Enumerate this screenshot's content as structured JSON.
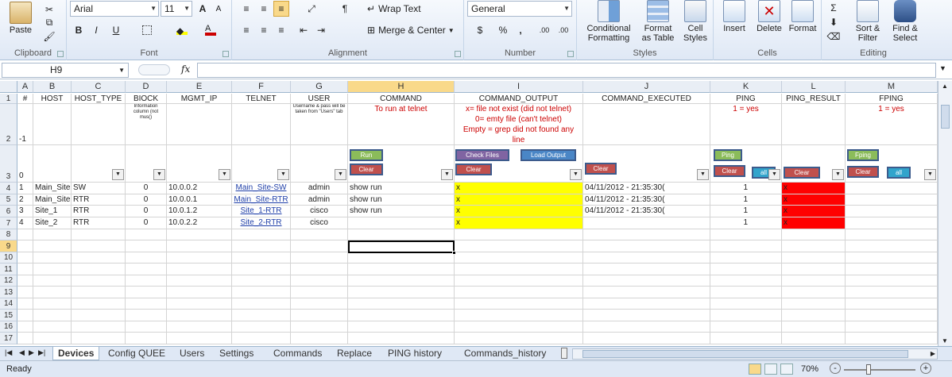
{
  "ribbon": {
    "clipboard": {
      "paste": "Paste",
      "label": "Clipboard"
    },
    "font": {
      "name": "Arial",
      "size": "11",
      "bold": "B",
      "italic": "I",
      "underline": "U",
      "grow": "A",
      "shrink": "A",
      "label": "Font"
    },
    "alignment": {
      "wrap_text": "Wrap Text",
      "merge_center": "Merge & Center",
      "label": "Alignment"
    },
    "number": {
      "format": "General",
      "currency": "$",
      "percent": "%",
      "comma": ",",
      "inc_dec": ".00",
      "dec_dec": ".00",
      "label": "Number"
    },
    "styles": {
      "conditional": "Conditional",
      "formatting": "Formatting",
      "format_as": "Format",
      "as_table": "as Table",
      "cell": "Cell",
      "cell_styles": "Styles",
      "label": "Styles"
    },
    "cells": {
      "insert": "Insert",
      "delete": "Delete",
      "format": "Format",
      "label": "Cells"
    },
    "editing": {
      "sort": "Sort &",
      "filter": "Filter",
      "find": "Find &",
      "select": "Select",
      "label": "Editing"
    }
  },
  "formula_bar": {
    "name_box": "H9",
    "fx": "fx",
    "value": ""
  },
  "columns": [
    "A",
    "B",
    "C",
    "D",
    "E",
    "F",
    "G",
    "H",
    "I",
    "J",
    "K",
    "L",
    "M"
  ],
  "row_numbers": [
    "1",
    "2",
    "3",
    "4",
    "5",
    "6",
    "7",
    "8",
    "9",
    "10",
    "11",
    "12",
    "13",
    "14",
    "15",
    "16",
    "17"
  ],
  "headers": {
    "a": "#",
    "b": "HOST",
    "c": "HOST_TYPE",
    "d": "BIOCK",
    "e": "MGMT_IP",
    "f": "TELNET",
    "g": "USER",
    "h": "COMMAND",
    "i": "COMMAND_OUTPUT",
    "j": "COMMAND_EXECUTED",
    "k": "PING",
    "l": "PING_RESULT",
    "m": "FPING"
  },
  "row2": {
    "a": "-1",
    "d": "Information column (not mus()",
    "g": "Username & pass will be taken from \"Users\" tab",
    "h": "To run at telnet",
    "i1": "x= file not exist (did not telnet)",
    "i2": "0= emty file (can't telnet)",
    "i3": "Empty = grep did not found any line",
    "k": "1 = yes",
    "m": "1 = yes"
  },
  "row3": {
    "a": "0"
  },
  "buttons": {
    "run": "Run",
    "clear": "Clear",
    "check_files": "Check Files",
    "load_output": "Load Output",
    "ping": "Ping",
    "all": "all",
    "fping": "Fping"
  },
  "rows": [
    {
      "num": "1",
      "host": "Main_Site",
      "type": "SW",
      "biock": "0",
      "ip": "10.0.0.2",
      "telnet": "Main_Site-SW",
      "user": "admin",
      "command": "show run",
      "output": "x",
      "executed": "04/11/2012 - 21:35:30(",
      "ping": "1",
      "ping_result": "x"
    },
    {
      "num": "2",
      "host": "Main_Site",
      "type": "RTR",
      "biock": "0",
      "ip": "10.0.0.1",
      "telnet": "Main_Site-RTR",
      "user": "admin",
      "command": "show run",
      "output": "x",
      "executed": "04/11/2012 - 21:35:30(",
      "ping": "1",
      "ping_result": "x"
    },
    {
      "num": "3",
      "host": "Site_1",
      "type": "RTR",
      "biock": "0",
      "ip": "10.0.1.2",
      "telnet": "Site_1-RTR",
      "user": "cisco",
      "command": "show run",
      "output": "x",
      "executed": "04/11/2012 - 21:35:30(",
      "ping": "1",
      "ping_result": "x"
    },
    {
      "num": "4",
      "host": "Site_2",
      "type": "RTR",
      "biock": "0",
      "ip": "10.0.2.2",
      "telnet": "Site_2-RTR",
      "user": "cisco",
      "command": "",
      "output": "x",
      "executed": "",
      "ping": "1",
      "ping_result": "x"
    }
  ],
  "sheet_tabs": [
    "Devices",
    "Config QUEE",
    "Users",
    "Settings",
    "Commands",
    "Replace",
    "PING history",
    "Commands_history"
  ],
  "status": {
    "ready": "Ready",
    "zoom": "70%",
    "zoom_out": "-",
    "zoom_in": "+"
  },
  "colors": {
    "yellow": "#ffff00",
    "red": "#ff0000",
    "ribbon": "#dfe8f5"
  }
}
